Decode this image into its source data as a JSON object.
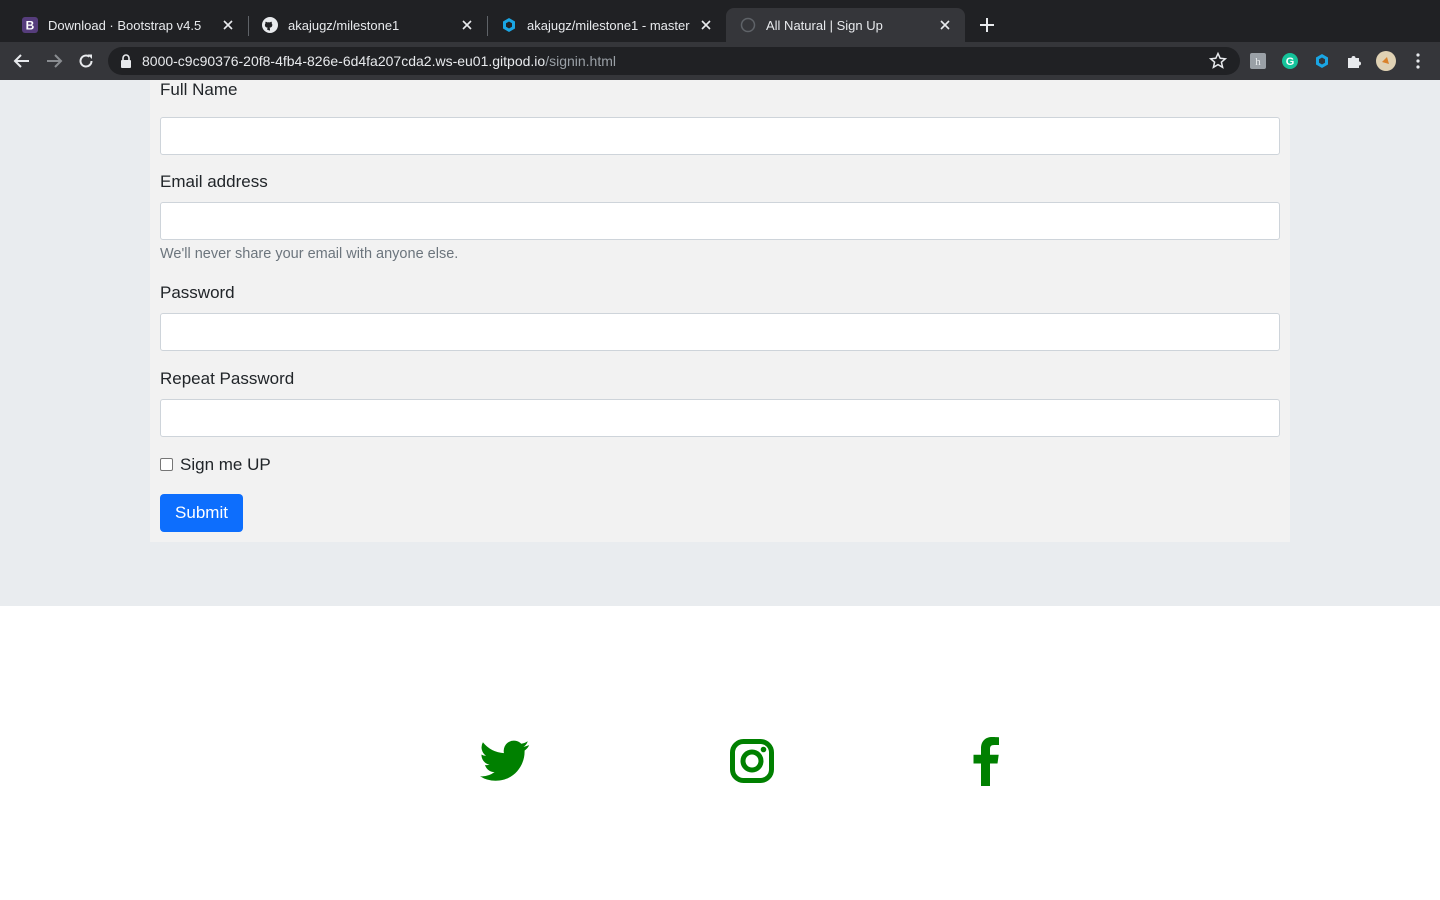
{
  "browser": {
    "tabs": [
      {
        "title": "Download · Bootstrap v4.5",
        "favicon": "bootstrap-favicon",
        "active": false
      },
      {
        "title": "akajugz/milestone1",
        "favicon": "github-favicon",
        "active": false
      },
      {
        "title": "akajugz/milestone1 - master",
        "favicon": "gitpod-favicon",
        "active": false
      },
      {
        "title": "All Natural | Sign Up",
        "favicon": "globe-favicon",
        "active": true
      }
    ],
    "url_host": "8000-c9c90376-20f8-4fb4-826e-6d4fa207cda2.ws-eu01.gitpod.io",
    "url_path": "/signin.html"
  },
  "form": {
    "full_name_label": "Full Name",
    "email_label": "Email address",
    "email_help": "We'll never share your email with anyone else.",
    "password_label": "Password",
    "repeat_password_label": "Repeat Password",
    "signup_check_label": "Sign me UP",
    "signup_checked": false,
    "submit_label": "Submit"
  },
  "footer": {
    "icons": [
      "twitter-icon",
      "instagram-icon",
      "facebook-icon"
    ],
    "icon_color": "#008000"
  },
  "colors": {
    "submit_bg": "#0d6efd",
    "band_bg": "#e9ecef",
    "card_bg": "#f2f2f2"
  }
}
